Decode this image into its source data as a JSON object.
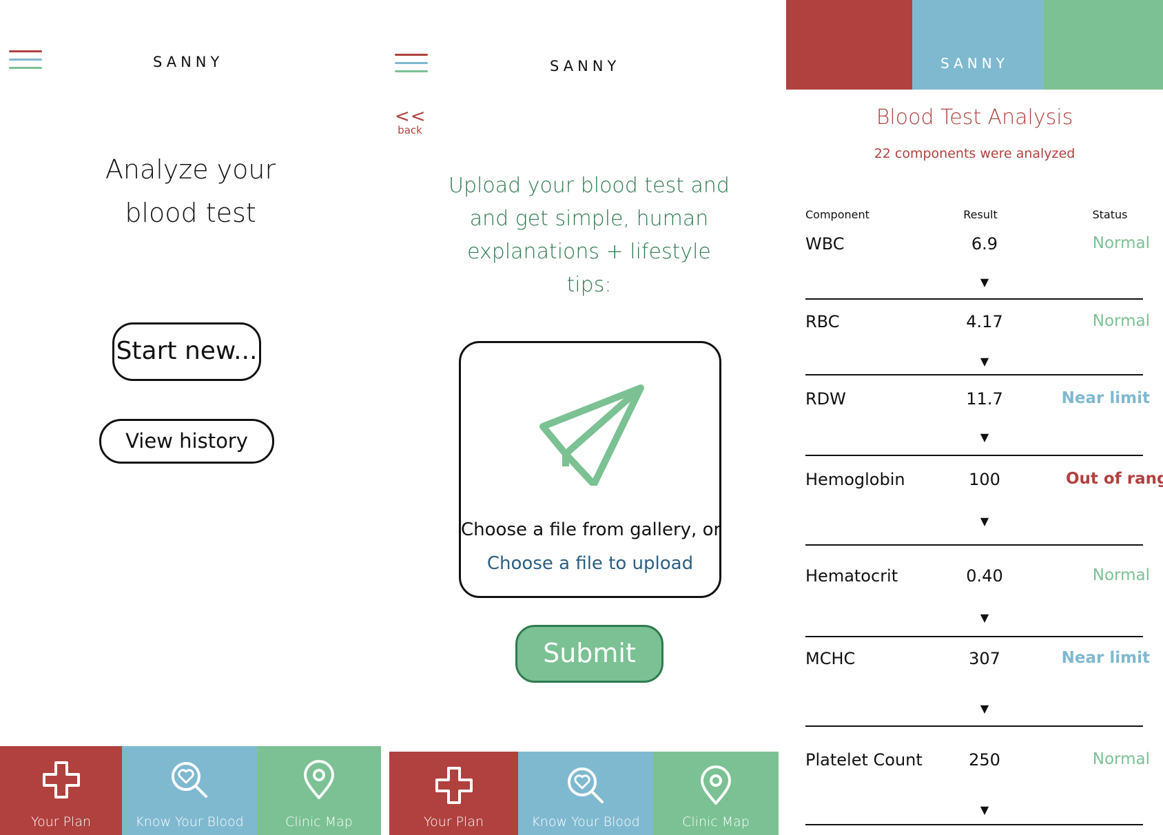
{
  "colors": {
    "red": "#b0413e",
    "blue": "#7fb9d0",
    "green": "#7bc193",
    "dark_green": "#2f7a4f",
    "link_blue": "#2b5f82"
  },
  "brand": "SANNY",
  "nav": {
    "tabs": [
      {
        "label": "Your Plan",
        "icon": "medical-cross-icon"
      },
      {
        "label": "Know Your Blood",
        "icon": "magnifier-heart-icon"
      },
      {
        "label": "Clinic Map",
        "icon": "map-pin-icon"
      }
    ]
  },
  "screen1": {
    "title_line1": "Analyze your",
    "title_line2": "blood test",
    "start_button": "Start new...",
    "history_button": "View history"
  },
  "screen2": {
    "back_chevron": "<<",
    "back_label": "back",
    "intro_line1": "Upload your blood test and",
    "intro_line2": "and get simple, human",
    "intro_line3": "explanations + lifestyle tips:",
    "gallery_text": "Choose a file from gallery, or",
    "upload_link": "Choose a file to upload",
    "submit_button": "Submit"
  },
  "screen3": {
    "title": "Blood Test Analysis",
    "subtitle": "22 components were analyzed",
    "columns": {
      "component": "Component",
      "result": "Result",
      "status": "Status"
    },
    "expand_arrow": "▼",
    "rows": [
      {
        "name": "WBC",
        "value": "6.9",
        "status": "Normal"
      },
      {
        "name": "RBC",
        "value": "4.17",
        "status": "Normal"
      },
      {
        "name": "RDW",
        "value": "11.7",
        "status": "Near limit"
      },
      {
        "name": "Hemoglobin",
        "value": "100",
        "status": "Out of range"
      },
      {
        "name": "Hematocrit",
        "value": "0.40",
        "status": "Normal"
      },
      {
        "name": "MCHC",
        "value": "307",
        "status": "Near limit"
      },
      {
        "name": "Platelet Count",
        "value": "250",
        "status": "Normal"
      }
    ]
  }
}
